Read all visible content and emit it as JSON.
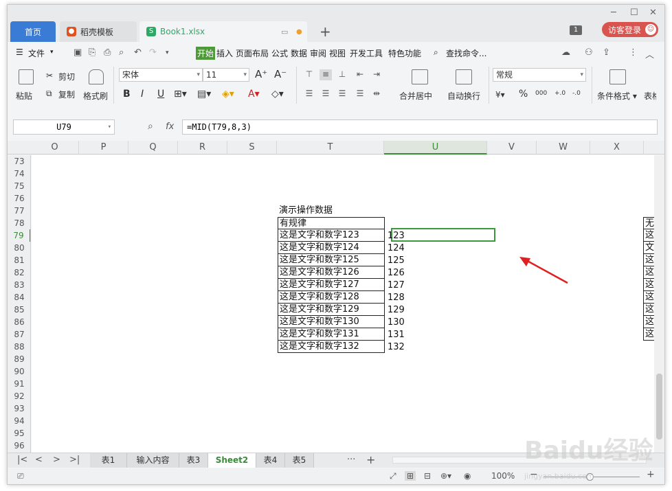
{
  "titlebar": {
    "tabs": [
      {
        "label": "首页"
      },
      {
        "label": "稻壳模板"
      },
      {
        "label": "Book1.xlsx"
      }
    ],
    "new_tab": "+",
    "count_badge": "1",
    "guest_login": "访客登录"
  },
  "menu": {
    "file": "文件",
    "items": [
      "开始",
      "插入",
      "页面布局",
      "公式",
      "数据",
      "审阅",
      "视图",
      "开发工具",
      "特色功能"
    ],
    "search": "查找命令..."
  },
  "ribbon": {
    "paste": "粘贴",
    "cut": "剪切",
    "copy": "复制",
    "format_painter": "格式刷",
    "font_name": "宋体",
    "font_size": "11",
    "merge_center": "合并居中",
    "wrap_text": "自动换行",
    "number_format": "常规",
    "conditional_format": "条件格式",
    "table_style": "表格"
  },
  "formula_bar": {
    "name_box": "U79",
    "fx": "fx",
    "formula": "=MID(T79,8,3)"
  },
  "columns": [
    "O",
    "P",
    "Q",
    "R",
    "S",
    "T",
    "U",
    "V",
    "W",
    "X"
  ],
  "rows": [
    "73",
    "74",
    "75",
    "76",
    "77",
    "78",
    "79",
    "80",
    "81",
    "82",
    "83",
    "84",
    "85",
    "86",
    "87",
    "88",
    "89",
    "90",
    "91",
    "92",
    "93",
    "94",
    "95",
    "96"
  ],
  "active_row": "79",
  "table": {
    "title": "演示操作数据",
    "header": "有规律",
    "left_items": [
      "这是文字和数字123",
      "这是文字和数字124",
      "这是文字和数字125",
      "这是文字和数字126",
      "这是文字和数字127",
      "这是文字和数字128",
      "这是文字和数字129",
      "这是文字和数字130",
      "这是文字和数字131",
      "这是文字和数字132"
    ],
    "results": [
      "123",
      "124",
      "125",
      "126",
      "127",
      "128",
      "129",
      "130",
      "131",
      "132"
    ],
    "right_header_partial": "无",
    "right_items_partial": [
      "这",
      "文",
      "这",
      "这",
      "这",
      "这",
      "这",
      "这",
      "这"
    ]
  },
  "sheet_tabs": [
    "表1",
    "输入内容",
    "表3",
    "Sheet2",
    "表4",
    "表5"
  ],
  "active_sheet": "Sheet2",
  "status": {
    "zoom": "100%"
  },
  "watermark": "Baidu经验",
  "watermark_sub": "jingyan.baidu.com",
  "colors": {
    "accent_green": "#4e9a3a",
    "selection": "#3a9a3a",
    "home_tab": "#3a7bd5",
    "login": "#d9534f",
    "arrow": "#e02020"
  }
}
